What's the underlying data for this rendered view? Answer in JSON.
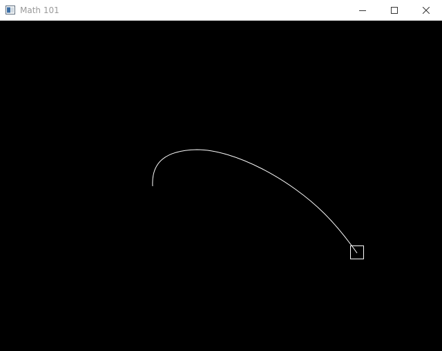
{
  "window": {
    "title": "Math 101",
    "icon": "window-app-icon",
    "controls": [
      "minimize-icon",
      "maximize-icon",
      "close-icon"
    ]
  },
  "canvas": {
    "background": "#000000",
    "stroke": "#ffffff"
  }
}
